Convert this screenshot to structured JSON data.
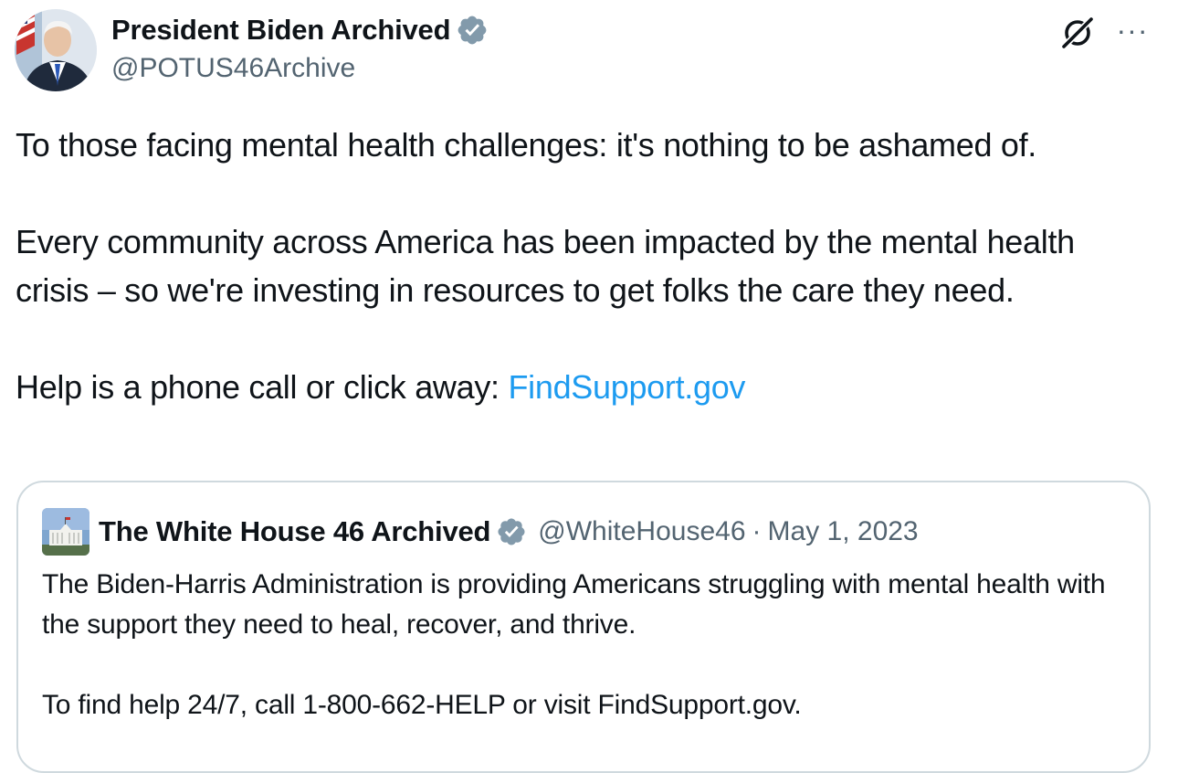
{
  "author": {
    "display_name": "President Biden Archived",
    "handle": "@POTUS46Archive",
    "verified": true,
    "avatar": "portrait-of-man-in-suit-with-flag"
  },
  "actions": {
    "grok_icon": "grok-icon",
    "more_icon": "more-icon",
    "more_label": "···"
  },
  "tweet": {
    "paragraphs": [
      "To those facing mental health challenges: it's nothing to be ashamed of.",
      "Every community across America has been impacted by the mental health crisis – so we're investing in resources to get folks the care they need."
    ],
    "cta_prefix": "Help is a phone call or click away: ",
    "link_text": "FindSupport.gov"
  },
  "quoted_tweet": {
    "display_name": "The White House 46 Archived",
    "handle": "@WhiteHouse46",
    "separator": "·",
    "date": "May 1, 2023",
    "verified": true,
    "avatar": "white-house-building",
    "paragraphs": [
      "The Biden-Harris Administration is providing Americans struggling with mental health with the support they need to heal, recover, and thrive.",
      "To find help 24/7, call 1-800-662-HELP or visit FindSupport.gov."
    ]
  },
  "colors": {
    "text": "#0f1419",
    "secondary": "#536471",
    "link": "#1d9bf0",
    "border": "#cfd9de",
    "verified_badge": "#829aab"
  }
}
